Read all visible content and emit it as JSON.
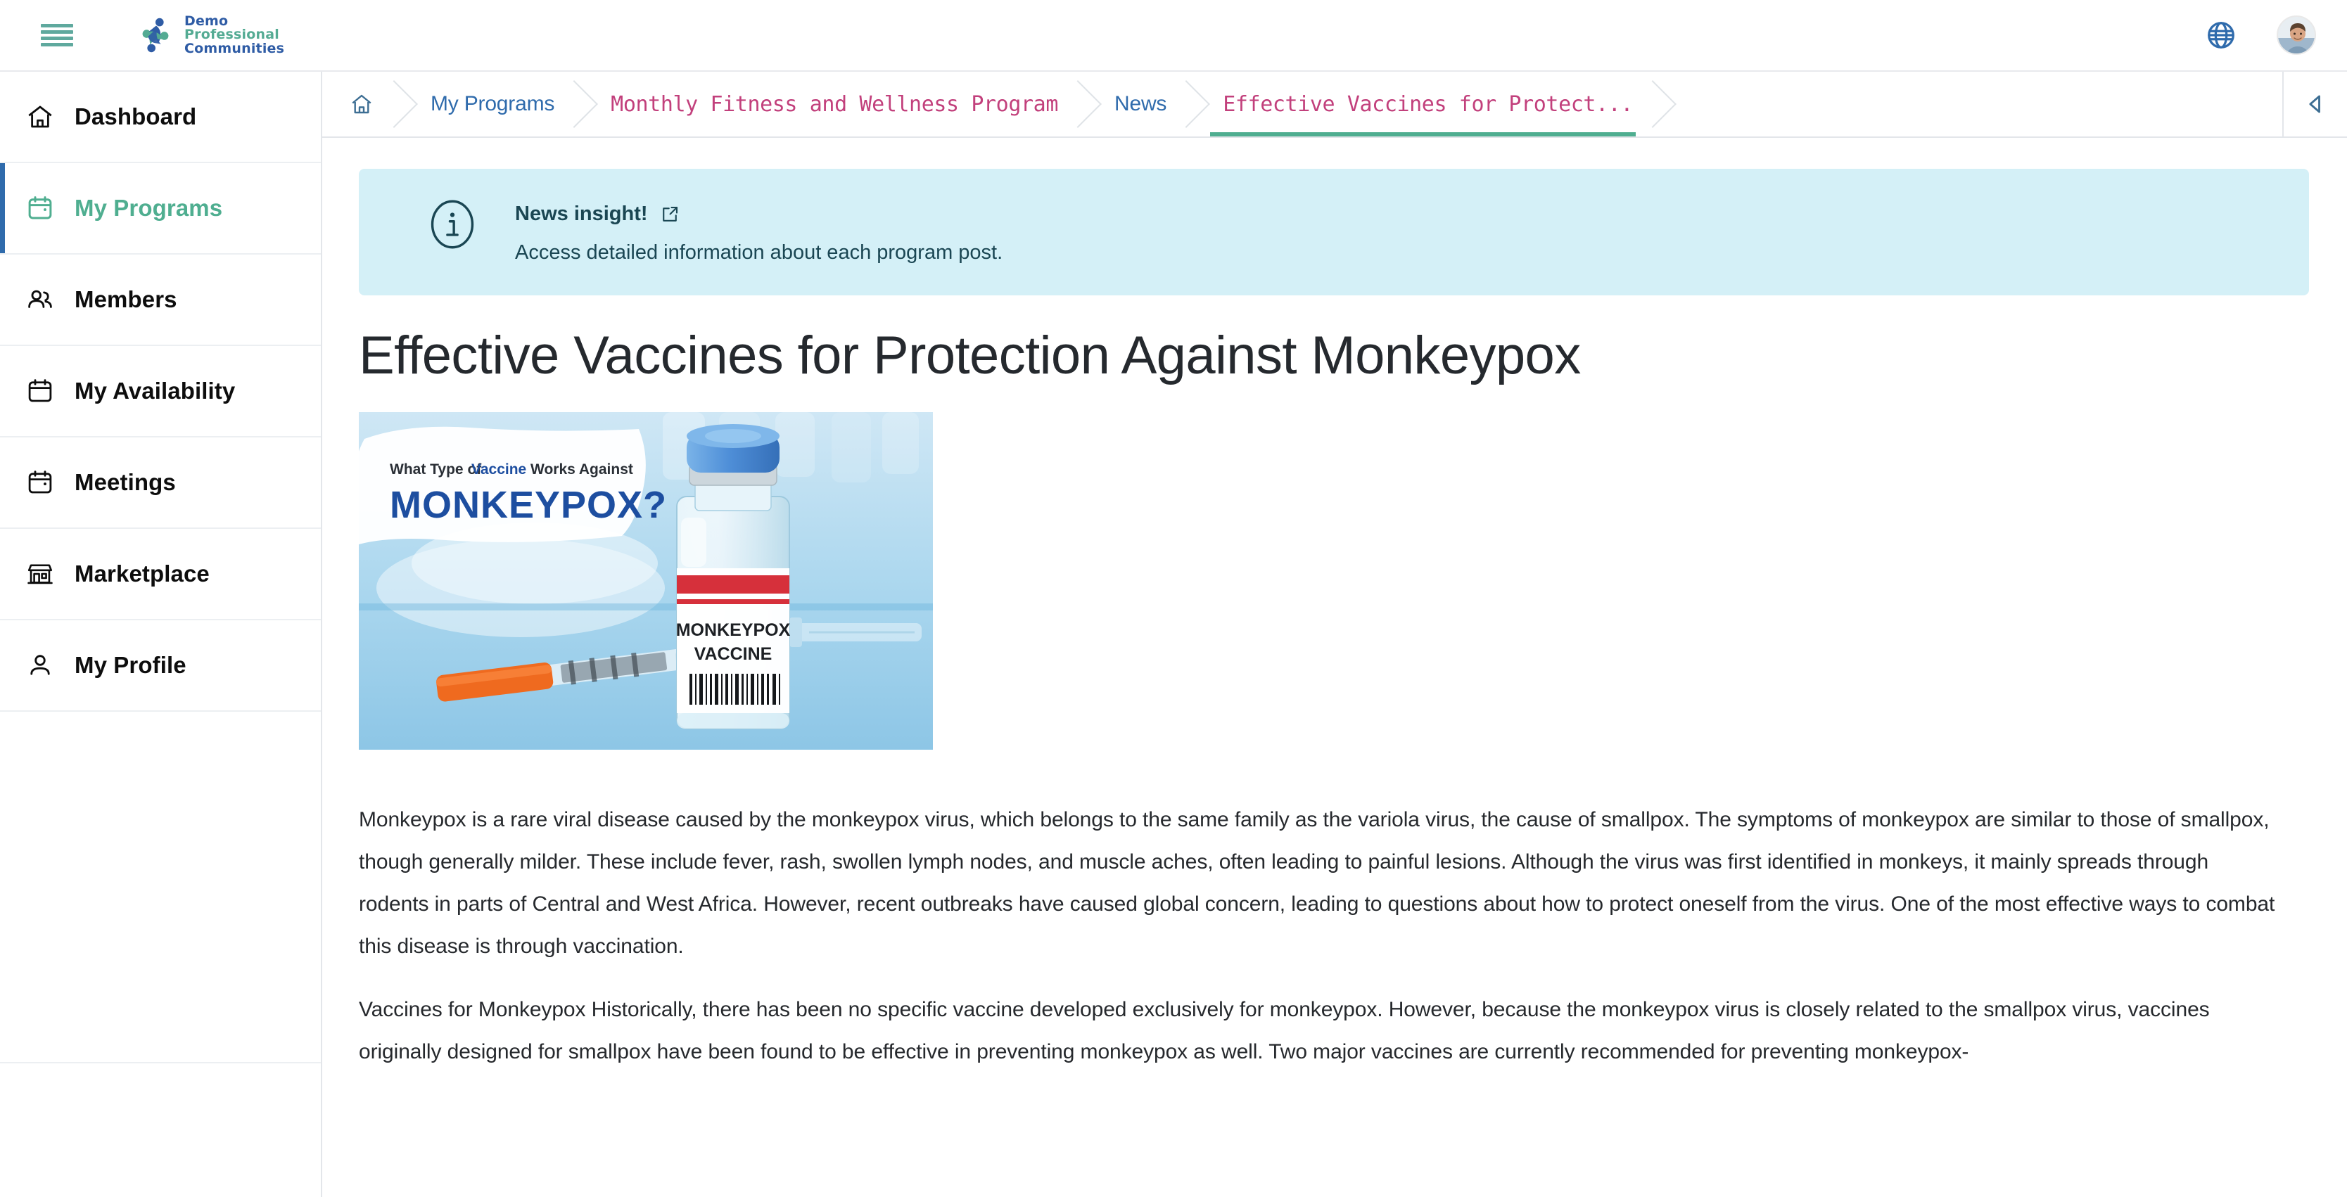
{
  "header": {
    "menu_icon": "hamburger-menu-icon",
    "brand": {
      "line1": "Demo",
      "line2": "Professional",
      "line3": "Communities"
    },
    "language_icon": "globe-icon",
    "avatar_icon": "user-avatar",
    "accent_teal": "#5fa99e",
    "brand_blue": "#2f5ca5",
    "brand_green": "#54ab93"
  },
  "sidebar": {
    "items": [
      {
        "label": "Dashboard",
        "icon": "home-icon",
        "active": false
      },
      {
        "label": "My Programs",
        "icon": "calendar-icon",
        "active": true
      },
      {
        "label": "Members",
        "icon": "users-icon",
        "active": false
      },
      {
        "label": "My Availability",
        "icon": "calendar-icon",
        "active": false
      },
      {
        "label": "Meetings",
        "icon": "calendar-icon",
        "active": false
      },
      {
        "label": "Marketplace",
        "icon": "storefront-icon",
        "active": false
      },
      {
        "label": "My Profile",
        "icon": "person-icon",
        "active": false
      }
    ],
    "active_border_color": "#2f6bac",
    "active_text_color": "#4fae90"
  },
  "breadcrumb": {
    "home_icon": "home-icon",
    "items": [
      {
        "label": "My Programs",
        "style": "link"
      },
      {
        "label": "Monthly Fitness and Wellness Program",
        "style": "current"
      },
      {
        "label": "News",
        "style": "link"
      },
      {
        "label": "Effective Vaccines for Protect...",
        "style": "current-active"
      }
    ],
    "collapse_icon": "triangle-left-icon",
    "link_color": "#2f6bac",
    "current_color": "#c2407c",
    "underline_color": "#4fae90"
  },
  "banner": {
    "icon": "info-circle-icon",
    "title": "News insight!",
    "external_link_icon": "external-link-icon",
    "subtitle": "Access detailed information about each program post.",
    "background": "#d4f0f7",
    "text_color": "#1a4653"
  },
  "article": {
    "title": "Effective Vaccines for Protection Against Monkeypox",
    "image": {
      "name": "monkeypox-vaccine-hero-image",
      "overlay_line1_prefix": "What Type of ",
      "overlay_line1_bold": "Vaccine",
      "overlay_line1_suffix": " Works Against",
      "overlay_line2": "MONKEYPOX?",
      "vial_label_line1": "MONKEYPOX",
      "vial_label_line2": "VACCINE"
    },
    "paragraphs": [
      "Monkeypox is a rare viral disease caused by the monkeypox virus, which belongs to the same family as the variola virus, the cause of smallpox. The symptoms of monkeypox are similar to those of smallpox, though generally milder. These include fever, rash, swollen lymph nodes, and muscle aches, often leading to painful lesions. Although the virus was first identified in monkeys, it mainly spreads through rodents in parts of Central and West Africa. However, recent outbreaks have caused global concern, leading to questions about how to protect oneself from the virus. One of the most effective ways to combat this disease is through vaccination.",
      "Vaccines for Monkeypox Historically, there has been no specific vaccine developed exclusively for monkeypox. However, because the monkeypox virus is closely related to the smallpox virus, vaccines originally designed for smallpox have been found to be effective in preventing monkeypox as well. Two major vaccines are currently recommended for preventing monkeypox-"
    ]
  }
}
